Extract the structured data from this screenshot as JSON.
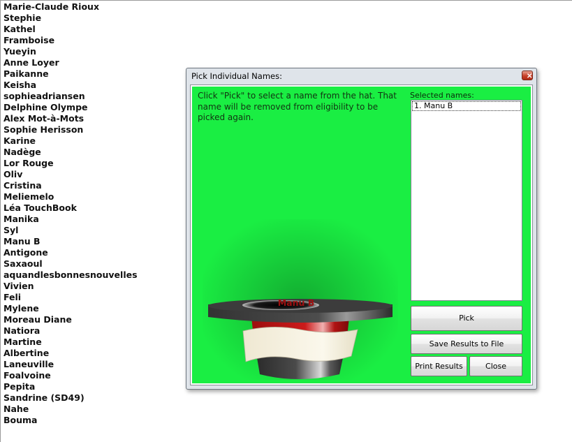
{
  "names": [
    "Marie-Claude Rioux",
    "Stephie",
    "Kathel",
    "Framboise",
    "Yueyin",
    "Anne Loyer",
    "Paikanne",
    "Keisha",
    "sophieadriansen",
    "Delphine Olympe",
    "Alex Mot-à-Mots",
    "Sophie Herisson",
    "Karine",
    "Nadège",
    "Lor Rouge",
    "Oliv",
    "Cristina",
    "Meliemelo",
    "Léa TouchBook",
    "Manika",
    "Syl",
    "Manu B",
    "Antigone",
    "Saxaoul",
    "aquandlesbonnesnouvelles",
    "Vivien",
    "Feli",
    "Mylene",
    "Moreau Diane",
    "Natiora",
    "Martine",
    "Albertine",
    "Laneuville",
    "Foalvoine",
    "Pepita",
    "Sandrine (SD49)",
    "Nahe",
    "Bouma"
  ],
  "dialog": {
    "title": "Pick Individual Names:",
    "close_glyph": "✕",
    "instructions": "Click \"Pick\" to select a name from the hat. That name will be removed from eligibility to be picked again.",
    "selected_label": "Selected names:",
    "selected_items": [
      "1. Manu B"
    ],
    "hat_name": "Manu B",
    "buttons": {
      "pick": "Pick",
      "save": "Save Results to File",
      "print": "Print Results",
      "close": "Close"
    },
    "colors": {
      "background": "#1aee43",
      "hat_band": "#c81818",
      "hat_name_text": "#9d1010"
    }
  },
  "icons": {
    "hat": "top-hat-icon",
    "close": "close-icon"
  }
}
